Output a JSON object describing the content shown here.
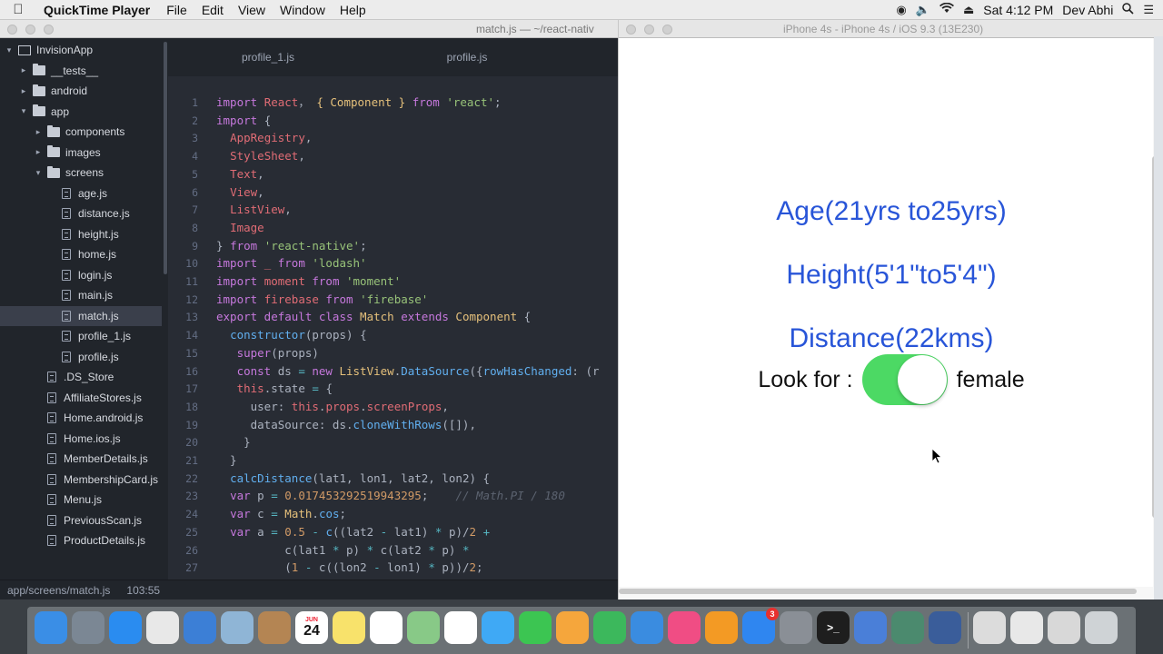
{
  "menubar": {
    "app_name": "QuickTime Player",
    "menus": [
      "File",
      "Edit",
      "View",
      "Window",
      "Help"
    ],
    "clock": "Sat 4:12 PM",
    "user": "Dev Abhi"
  },
  "editor": {
    "window_title": "match.js — ~/react-nativ",
    "tabs": [
      {
        "label": "profile_1.js"
      },
      {
        "label": "profile.js"
      }
    ],
    "tree": [
      {
        "label": "InvisionApp",
        "kind": "root",
        "indent": 0,
        "expanded": true
      },
      {
        "label": "__tests__",
        "kind": "folder",
        "indent": 1,
        "expanded": false
      },
      {
        "label": "android",
        "kind": "folder",
        "indent": 1,
        "expanded": false
      },
      {
        "label": "app",
        "kind": "folder",
        "indent": 1,
        "expanded": true
      },
      {
        "label": "components",
        "kind": "folder",
        "indent": 2,
        "expanded": false
      },
      {
        "label": "images",
        "kind": "folder",
        "indent": 2,
        "expanded": false
      },
      {
        "label": "screens",
        "kind": "folder",
        "indent": 2,
        "expanded": true
      },
      {
        "label": "age.js",
        "kind": "file",
        "indent": 3
      },
      {
        "label": "distance.js",
        "kind": "file",
        "indent": 3
      },
      {
        "label": "height.js",
        "kind": "file",
        "indent": 3
      },
      {
        "label": "home.js",
        "kind": "file",
        "indent": 3
      },
      {
        "label": "login.js",
        "kind": "file",
        "indent": 3
      },
      {
        "label": "main.js",
        "kind": "file",
        "indent": 3
      },
      {
        "label": "match.js",
        "kind": "file",
        "indent": 3,
        "selected": true
      },
      {
        "label": "profile_1.js",
        "kind": "file",
        "indent": 3
      },
      {
        "label": "profile.js",
        "kind": "file",
        "indent": 3
      },
      {
        "label": ".DS_Store",
        "kind": "file",
        "indent": 2
      },
      {
        "label": "AffiliateStores.js",
        "kind": "file",
        "indent": 2
      },
      {
        "label": "Home.android.js",
        "kind": "file",
        "indent": 2
      },
      {
        "label": "Home.ios.js",
        "kind": "file",
        "indent": 2
      },
      {
        "label": "MemberDetails.js",
        "kind": "file",
        "indent": 2
      },
      {
        "label": "MembershipCard.js",
        "kind": "file",
        "indent": 2
      },
      {
        "label": "Menu.js",
        "kind": "file",
        "indent": 2
      },
      {
        "label": "PreviousScan.js",
        "kind": "file",
        "indent": 2
      },
      {
        "label": "ProductDetails.js",
        "kind": "file",
        "indent": 2
      }
    ],
    "code_lines": [
      [
        [
          "kw",
          "import "
        ],
        [
          "prop",
          "React"
        ],
        [
          "",
          "， "
        ],
        [
          "cls",
          "{ Component }"
        ],
        [
          "kw",
          " from "
        ],
        [
          "str",
          "'react'"
        ],
        [
          "",
          ";"
        ]
      ],
      [
        [
          "kw",
          "import "
        ],
        [
          "",
          "{"
        ]
      ],
      [
        [
          "",
          "  "
        ],
        [
          "prop",
          "AppRegistry"
        ],
        [
          "",
          ","
        ]
      ],
      [
        [
          "",
          "  "
        ],
        [
          "prop",
          "StyleSheet"
        ],
        [
          "",
          ","
        ]
      ],
      [
        [
          "",
          "  "
        ],
        [
          "prop",
          "Text"
        ],
        [
          "",
          ","
        ]
      ],
      [
        [
          "",
          "  "
        ],
        [
          "prop",
          "View"
        ],
        [
          "",
          ","
        ]
      ],
      [
        [
          "",
          "  "
        ],
        [
          "prop",
          "ListView"
        ],
        [
          "",
          ","
        ]
      ],
      [
        [
          "",
          "  "
        ],
        [
          "prop",
          "Image"
        ]
      ],
      [
        [
          "",
          "} "
        ],
        [
          "kw",
          "from "
        ],
        [
          "str",
          "'react-native'"
        ],
        [
          "",
          ";"
        ]
      ],
      [
        [
          "kw",
          "import "
        ],
        [
          "prop",
          "_"
        ],
        [
          "kw",
          " from "
        ],
        [
          "str",
          "'lodash'"
        ]
      ],
      [
        [
          "kw",
          "import "
        ],
        [
          "prop",
          "moment"
        ],
        [
          "kw",
          " from "
        ],
        [
          "str",
          "'moment'"
        ]
      ],
      [
        [
          "kw",
          "import "
        ],
        [
          "prop",
          "firebase"
        ],
        [
          "kw",
          " from "
        ],
        [
          "str",
          "'firebase'"
        ]
      ],
      [
        [
          "kw",
          "export default class "
        ],
        [
          "cls",
          "Match"
        ],
        [
          "kw",
          " extends "
        ],
        [
          "cls",
          "Component"
        ],
        [
          "",
          " {"
        ]
      ],
      [
        [
          "",
          "  "
        ],
        [
          "fn",
          "constructor"
        ],
        [
          "",
          "(props) {"
        ]
      ],
      [
        [
          "",
          "   "
        ],
        [
          "kw",
          "super"
        ],
        [
          "",
          "(props)"
        ]
      ],
      [
        [
          "",
          "   "
        ],
        [
          "kw",
          "const "
        ],
        [
          "",
          "ds "
        ],
        [
          "op",
          "= "
        ],
        [
          "kw",
          "new "
        ],
        [
          "cls",
          "ListView"
        ],
        [
          "",
          "."
        ],
        [
          "fn",
          "DataSource"
        ],
        [
          "",
          "({"
        ],
        [
          "fn",
          "rowHasChanged"
        ],
        [
          "",
          ": (r"
        ]
      ],
      [
        [
          "",
          "   "
        ],
        [
          "prop",
          "this"
        ],
        [
          "",
          ".state "
        ],
        [
          "op",
          "= "
        ],
        [
          "",
          "{"
        ]
      ],
      [
        [
          "",
          "     user: "
        ],
        [
          "prop",
          "this"
        ],
        [
          "",
          "."
        ],
        [
          "prop",
          "props"
        ],
        [
          "",
          "."
        ],
        [
          "prop",
          "screenProps"
        ],
        [
          "",
          ","
        ]
      ],
      [
        [
          "",
          "     dataSource: ds."
        ],
        [
          "fn",
          "cloneWithRows"
        ],
        [
          "",
          "([]),"
        ]
      ],
      [
        [
          "",
          "    }"
        ]
      ],
      [
        [
          "",
          "  }"
        ]
      ],
      [
        [
          "",
          "  "
        ],
        [
          "fn",
          "calcDistance"
        ],
        [
          "",
          "(lat1, lon1, lat2, lon2) {"
        ]
      ],
      [
        [
          "",
          "  "
        ],
        [
          "kw",
          "var "
        ],
        [
          "",
          "p "
        ],
        [
          "op",
          "= "
        ],
        [
          "num",
          "0.017453292519943295"
        ],
        [
          "",
          ";    "
        ],
        [
          "cm",
          "// Math.PI / 180"
        ]
      ],
      [
        [
          "",
          "  "
        ],
        [
          "kw",
          "var "
        ],
        [
          "",
          "c "
        ],
        [
          "op",
          "= "
        ],
        [
          "cls",
          "Math"
        ],
        [
          "",
          "."
        ],
        [
          "fn",
          "cos"
        ],
        [
          "",
          ";"
        ]
      ],
      [
        [
          "",
          "  "
        ],
        [
          "kw",
          "var "
        ],
        [
          "",
          "a "
        ],
        [
          "op",
          "= "
        ],
        [
          "num",
          "0.5"
        ],
        [
          "op",
          " - "
        ],
        [
          "fn",
          "c"
        ],
        [
          "",
          "((lat2 "
        ],
        [
          "op",
          "-"
        ],
        [
          "",
          " lat1) "
        ],
        [
          "op",
          "*"
        ],
        [
          "",
          " p)/"
        ],
        [
          "num",
          "2"
        ],
        [
          "op",
          " +"
        ]
      ],
      [
        [
          "",
          "          c(lat1 "
        ],
        [
          "op",
          "*"
        ],
        [
          "",
          " p) "
        ],
        [
          "op",
          "*"
        ],
        [
          "",
          " c(lat2 "
        ],
        [
          "op",
          "*"
        ],
        [
          "",
          " p) "
        ],
        [
          "op",
          "*"
        ]
      ],
      [
        [
          "",
          "          ("
        ],
        [
          "num",
          "1"
        ],
        [
          "op",
          " -"
        ],
        [
          "",
          " c((lon2 "
        ],
        [
          "op",
          "-"
        ],
        [
          "",
          " lon1) "
        ],
        [
          "op",
          "*"
        ],
        [
          "",
          " p))/"
        ],
        [
          "num",
          "2"
        ],
        [
          "",
          ";"
        ]
      ],
      [
        [
          "",
          " "
        ]
      ]
    ],
    "status": {
      "path": "app/screens/match.js",
      "cursor": "103:55"
    }
  },
  "simulator": {
    "window_title": "iPhone 4s - iPhone 4s / iOS 9.3 (13E230)",
    "age_label": "Age(21yrs to25yrs)",
    "height_label": "Height(5'1\"to5'4\")",
    "distance_label": "Distance(22kms)",
    "look_for_label": "Look for :",
    "look_for_value": "female",
    "toggle_on": true,
    "accent_color": "#2855d8",
    "toggle_color": "#4cd964"
  },
  "dock": {
    "calendar_month": "JUN",
    "calendar_day": "24",
    "app_store_badge": "3",
    "apps": [
      "finder-icon",
      "launchpad-icon",
      "safari-icon",
      "chrome-icon",
      "xcode-icon",
      "preview-icon",
      "contacts-icon",
      "calendar-icon",
      "notes-icon",
      "reminders-icon",
      "maps-icon",
      "photos-icon",
      "messages-icon",
      "facetime-icon",
      "pages-icon",
      "numbers-icon",
      "keynote-icon",
      "itunes-icon",
      "ibooks-icon",
      "app-store-icon",
      "system-preferences-icon",
      "terminal-icon",
      "simulator-icon",
      "atom-icon",
      "quicktime-icon",
      "window-thumb-icon",
      "finder-window-icon",
      "keyboard-viewer-icon",
      "trash-icon"
    ]
  }
}
